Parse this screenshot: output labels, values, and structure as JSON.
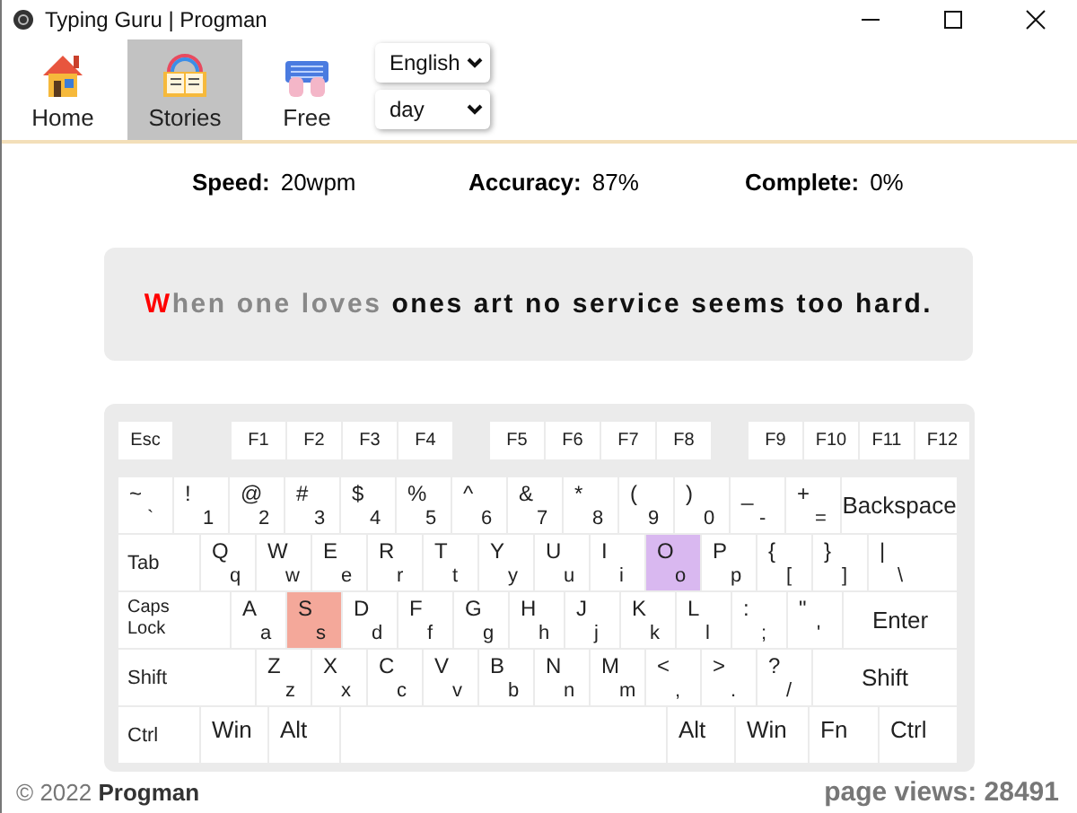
{
  "window": {
    "title": "Typing Guru | Progman"
  },
  "tabs": [
    {
      "label": "Home",
      "kind": "home",
      "selected": false
    },
    {
      "label": "Stories",
      "kind": "stories",
      "selected": true
    },
    {
      "label": "Free",
      "kind": "free",
      "selected": false
    }
  ],
  "selects": [
    {
      "value": "English"
    },
    {
      "value": "day"
    }
  ],
  "stats": [
    {
      "label": "Speed:",
      "value": "20wpm"
    },
    {
      "label": "Accuracy:",
      "value": "87%"
    },
    {
      "label": "Complete:",
      "value": "0%"
    }
  ],
  "sentence": [
    {
      "text": "W",
      "kind": "error"
    },
    {
      "text": "hen one loves ",
      "kind": "typed"
    },
    {
      "text": "ones art no service seems too hard.",
      "kind": "pending"
    }
  ],
  "keyboard": {
    "rows": [
      {
        "keys": [
          {
            "kind": "label",
            "label": "Esc"
          },
          {
            "kind": "label",
            "label": "F1"
          },
          {
            "kind": "label",
            "label": "F2"
          },
          {
            "kind": "label",
            "label": "F3"
          },
          {
            "kind": "label",
            "label": "F4"
          },
          {
            "kind": "label",
            "label": "F5"
          },
          {
            "kind": "label",
            "label": "F6"
          },
          {
            "kind": "label",
            "label": "F7"
          },
          {
            "kind": "label",
            "label": "F8"
          },
          {
            "kind": "label",
            "label": "F9"
          },
          {
            "kind": "label",
            "label": "F10"
          },
          {
            "kind": "label",
            "label": "F11"
          },
          {
            "kind": "label",
            "label": "F12"
          }
        ]
      },
      {
        "keys": [
          {
            "kind": "dual",
            "upper": "~",
            "lower": "`"
          },
          {
            "kind": "dual",
            "upper": "!",
            "lower": "1"
          },
          {
            "kind": "dual",
            "upper": "@",
            "lower": "2"
          },
          {
            "kind": "dual",
            "upper": "#",
            "lower": "3"
          },
          {
            "kind": "dual",
            "upper": "$",
            "lower": "4"
          },
          {
            "kind": "dual",
            "upper": "%",
            "lower": "5"
          },
          {
            "kind": "dual",
            "upper": "^",
            "lower": "6"
          },
          {
            "kind": "dual",
            "upper": "&",
            "lower": "7"
          },
          {
            "kind": "dual",
            "upper": "*",
            "lower": "8"
          },
          {
            "kind": "dual",
            "upper": "(",
            "lower": "9"
          },
          {
            "kind": "dual",
            "upper": ")",
            "lower": "0"
          },
          {
            "kind": "dual",
            "upper": "_",
            "lower": "-"
          },
          {
            "kind": "dual",
            "upper": "+",
            "lower": "="
          },
          {
            "kind": "label",
            "label": "Backspace"
          }
        ]
      },
      {
        "keys": [
          {
            "kind": "label",
            "label": "Tab"
          },
          {
            "kind": "dual",
            "upper": "Q",
            "lower": "q"
          },
          {
            "kind": "dual",
            "upper": "W",
            "lower": "w"
          },
          {
            "kind": "dual",
            "upper": "E",
            "lower": "e"
          },
          {
            "kind": "dual",
            "upper": "R",
            "lower": "r"
          },
          {
            "kind": "dual",
            "upper": "T",
            "lower": "t"
          },
          {
            "kind": "dual",
            "upper": "Y",
            "lower": "y"
          },
          {
            "kind": "dual",
            "upper": "U",
            "lower": "u"
          },
          {
            "kind": "dual",
            "upper": "I",
            "lower": "i"
          },
          {
            "kind": "dual",
            "upper": "O",
            "lower": "o",
            "color": "#d9b8f0"
          },
          {
            "kind": "dual",
            "upper": "P",
            "lower": "p"
          },
          {
            "kind": "dual",
            "upper": "{",
            "lower": "["
          },
          {
            "kind": "dual",
            "upper": "}",
            "lower": "]"
          },
          {
            "kind": "dual",
            "upper": "|",
            "lower": "\\"
          }
        ]
      },
      {
        "keys": [
          {
            "kind": "stacked",
            "label": "Caps Lock"
          },
          {
            "kind": "dual",
            "upper": "A",
            "lower": "a"
          },
          {
            "kind": "dual",
            "upper": "S",
            "lower": "s",
            "color": "#f4a89a"
          },
          {
            "kind": "dual",
            "upper": "D",
            "lower": "d"
          },
          {
            "kind": "dual",
            "upper": "F",
            "lower": "f"
          },
          {
            "kind": "dual",
            "upper": "G",
            "lower": "g"
          },
          {
            "kind": "dual",
            "upper": "H",
            "lower": "h"
          },
          {
            "kind": "dual",
            "upper": "J",
            "lower": "j"
          },
          {
            "kind": "dual",
            "upper": "K",
            "lower": "k"
          },
          {
            "kind": "dual",
            "upper": "L",
            "lower": "l"
          },
          {
            "kind": "dual",
            "upper": ":",
            "lower": ";"
          },
          {
            "kind": "dual",
            "upper": "\"",
            "lower": "'"
          },
          {
            "kind": "label",
            "label": "Enter"
          }
        ]
      },
      {
        "keys": [
          {
            "kind": "label",
            "label": "Shift"
          },
          {
            "kind": "dual",
            "upper": "Z",
            "lower": "z"
          },
          {
            "kind": "dual",
            "upper": "X",
            "lower": "x"
          },
          {
            "kind": "dual",
            "upper": "C",
            "lower": "c"
          },
          {
            "kind": "dual",
            "upper": "V",
            "lower": "v"
          },
          {
            "kind": "dual",
            "upper": "B",
            "lower": "b"
          },
          {
            "kind": "dual",
            "upper": "N",
            "lower": "n"
          },
          {
            "kind": "dual",
            "upper": "M",
            "lower": "m"
          },
          {
            "kind": "dual",
            "upper": "<",
            "lower": ","
          },
          {
            "kind": "dual",
            "upper": ">",
            "lower": "."
          },
          {
            "kind": "dual",
            "upper": "?",
            "lower": "/"
          },
          {
            "kind": "label",
            "label": "Shift"
          }
        ]
      },
      {
        "keys": [
          {
            "kind": "label",
            "label": "Ctrl"
          },
          {
            "kind": "top",
            "label": "Win"
          },
          {
            "kind": "top",
            "label": "Alt"
          },
          {
            "kind": "space"
          },
          {
            "kind": "top",
            "label": "Alt"
          },
          {
            "kind": "top",
            "label": "Win"
          },
          {
            "kind": "top",
            "label": "Fn"
          },
          {
            "kind": "top",
            "label": "Ctrl"
          }
        ]
      }
    ]
  },
  "footer": {
    "copyright": "© 2022 **Progman**",
    "views": "page views: 28491"
  }
}
